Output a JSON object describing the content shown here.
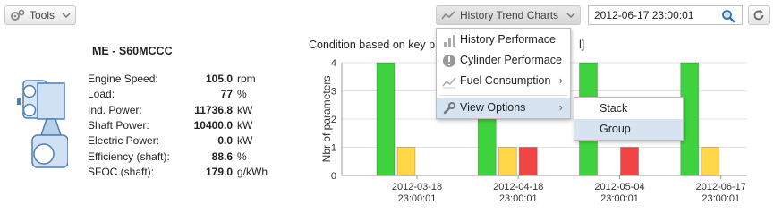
{
  "toolbar": {
    "tools_label": "Tools",
    "history_label": "History Trend Charts",
    "datetime_value": "2012-06-17 23:00:01"
  },
  "engine": {
    "title": "ME - S60MCCC",
    "params": [
      {
        "label": "Engine Speed:",
        "value": "105.0",
        "unit": "rpm"
      },
      {
        "label": "Load:",
        "value": "77",
        "unit": "%"
      },
      {
        "label": "Ind. Power:",
        "value": "11736.8",
        "unit": "kW"
      },
      {
        "label": "Shaft Power:",
        "value": "10400.0",
        "unit": "kW"
      },
      {
        "label": "Electric Power:",
        "value": "0.0",
        "unit": "kW"
      },
      {
        "label": "Efficiency (shaft):",
        "value": "88.6",
        "unit": "%"
      },
      {
        "label": "SFOC (shaft):",
        "value": "179.0",
        "unit": "g/kWh"
      }
    ]
  },
  "chart_title_left": "Condition based on key p",
  "chart_title_right": "l]",
  "menu": {
    "items": [
      {
        "label": "History Performace",
        "icon": "bar-chart-icon"
      },
      {
        "label": "Cylinder Performace",
        "icon": "exclamation-icon"
      },
      {
        "label": "Fuel Consumption",
        "icon": "line-chart-icon"
      },
      {
        "label": "View Options",
        "icon": "wrench-icon"
      }
    ],
    "submenu": [
      {
        "label": "Stack"
      },
      {
        "label": "Group"
      }
    ]
  },
  "colors": {
    "green": "#3ed33e",
    "yellow": "#ffd84a",
    "red": "#f04545",
    "menu_highlight": "#d6e3f1"
  },
  "chart_data": {
    "type": "bar",
    "ylabel": "Nbr of parameters",
    "ylim": [
      0,
      4
    ],
    "yticks": [
      "0",
      "1",
      "2",
      "3",
      "4"
    ],
    "categories": [
      "2012-03-18\n23:00:01",
      "2012-04-18\n23:00:01",
      "2012-05-04\n23:00:01",
      "2012-06-17\n23:00:01"
    ],
    "category_lines": [
      [
        "2012-03-18",
        "23:00:01"
      ],
      [
        "2012-04-18",
        "23:00:01"
      ],
      [
        "2012-05-04",
        "23:00:01"
      ],
      [
        "2012-06-17",
        "23:00:01"
      ]
    ],
    "series": [
      {
        "color": "#3ed33e",
        "values": [
          4,
          4,
          4,
          4
        ]
      },
      {
        "color": "#ffd84a",
        "values": [
          1,
          1,
          0,
          1
        ]
      },
      {
        "color": "#f04545",
        "values": [
          0,
          1,
          1,
          0
        ]
      }
    ],
    "grid": true
  }
}
